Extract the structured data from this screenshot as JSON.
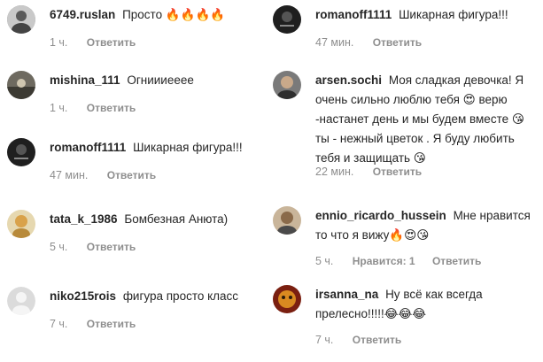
{
  "left": [
    {
      "user": "6749.ruslan",
      "text": "Просто 🔥🔥🔥🔥",
      "time": "1 ч.",
      "reply": "Ответить"
    },
    {
      "user": "mishina_111",
      "text": "Огниииееее",
      "time": "1 ч.",
      "reply": "Ответить"
    },
    {
      "user": "romanoff1111",
      "text": "Шикарная фигура!!!",
      "time": "47 мин.",
      "reply": "Ответить"
    },
    {
      "user": "tata_k_1986",
      "text": "Бомбезная Анюта)",
      "time": "5 ч.",
      "reply": "Ответить"
    },
    {
      "user": "niko215rois",
      "text": "фигура просто класс",
      "time": "7 ч.",
      "reply": "Ответить"
    }
  ],
  "right": [
    {
      "user": "romanoff1111",
      "text": "Шикарная фигура!!!",
      "time": "47 мин.",
      "reply": "Ответить"
    },
    {
      "user": "arsen.sochi",
      "text": "Моя сладкая девочка! Я очень сильно люблю тебя 😍 верю -настанет день и мы будем вместе 😘 ты - нежный цветок . Я буду любить тебя и защищать 😘",
      "time": "22 мин.",
      "reply": "Ответить"
    },
    {
      "user": "ennio_ricardo_hussein",
      "text": "Мне нравится то что я вижу🔥😍😘",
      "time": "5 ч.",
      "likes": "Нравится: 1",
      "reply": "Ответить"
    },
    {
      "user": "irsanna_na",
      "text": "Ну всё как всегда прелесно!!!!!😂😂😂",
      "time": "7 ч.",
      "reply": "Ответить"
    }
  ]
}
